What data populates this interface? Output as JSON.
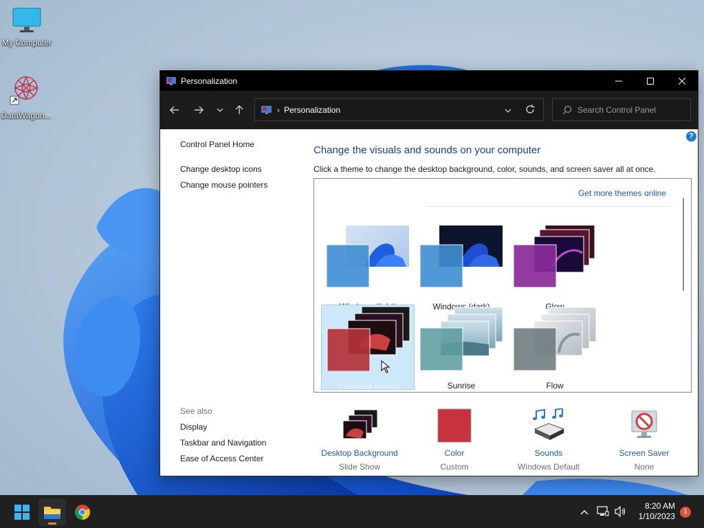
{
  "desktop": {
    "icons": [
      {
        "label": "My Computer",
        "icon": "monitor-icon"
      },
      {
        "label": "DataWagon...",
        "icon": "datawagon-shortcut-icon"
      }
    ]
  },
  "window": {
    "title": "Personalization",
    "controls": {
      "minimize": "minimize-icon",
      "maximize": "maximize-icon",
      "close": "close-icon"
    },
    "address": {
      "crumb": "Personalization"
    },
    "search": {
      "placeholder": "Search Control Panel"
    }
  },
  "sidebar": {
    "home": "Control Panel Home",
    "links": [
      "Change desktop icons",
      "Change mouse pointers"
    ],
    "see_also_heading": "See also",
    "see_also": [
      "Display",
      "Taskbar and Navigation",
      "Ease of Access Center"
    ]
  },
  "main": {
    "title": "Change the visuals and sounds on your computer",
    "subtitle": "Click a theme to change the desktop background, color, sounds, and screen saver all at once.",
    "get_more": "Get more themes online",
    "themes": [
      {
        "name": "Windows (light)",
        "color": "#3f8fd2"
      },
      {
        "name": "Windows (dark)",
        "color": "#3f8fd2"
      },
      {
        "name": "Glow",
        "color": "#8a2a9c"
      },
      {
        "name": "Captured Motion",
        "color": "#b5323b",
        "selected": true
      },
      {
        "name": "Sunrise",
        "color": "#5f9ea0"
      },
      {
        "name": "Flow",
        "color": "#6e7a80"
      }
    ]
  },
  "bottom": [
    {
      "name": "Desktop Background",
      "sub": "Slide Show",
      "icon": "desktop-background-icon"
    },
    {
      "name": "Color",
      "sub": "Custom",
      "icon": "color-swatch-icon",
      "color": "#c8323e"
    },
    {
      "name": "Sounds",
      "sub": "Windows Default",
      "icon": "sounds-icon"
    },
    {
      "name": "Screen Saver",
      "sub": "None",
      "icon": "screen-saver-icon"
    }
  ],
  "taskbar": {
    "apps": [
      "start-icon",
      "file-explorer-icon",
      "chrome-icon"
    ],
    "time": "8:20 AM",
    "date": "1/10/2023",
    "notifications": "1"
  }
}
